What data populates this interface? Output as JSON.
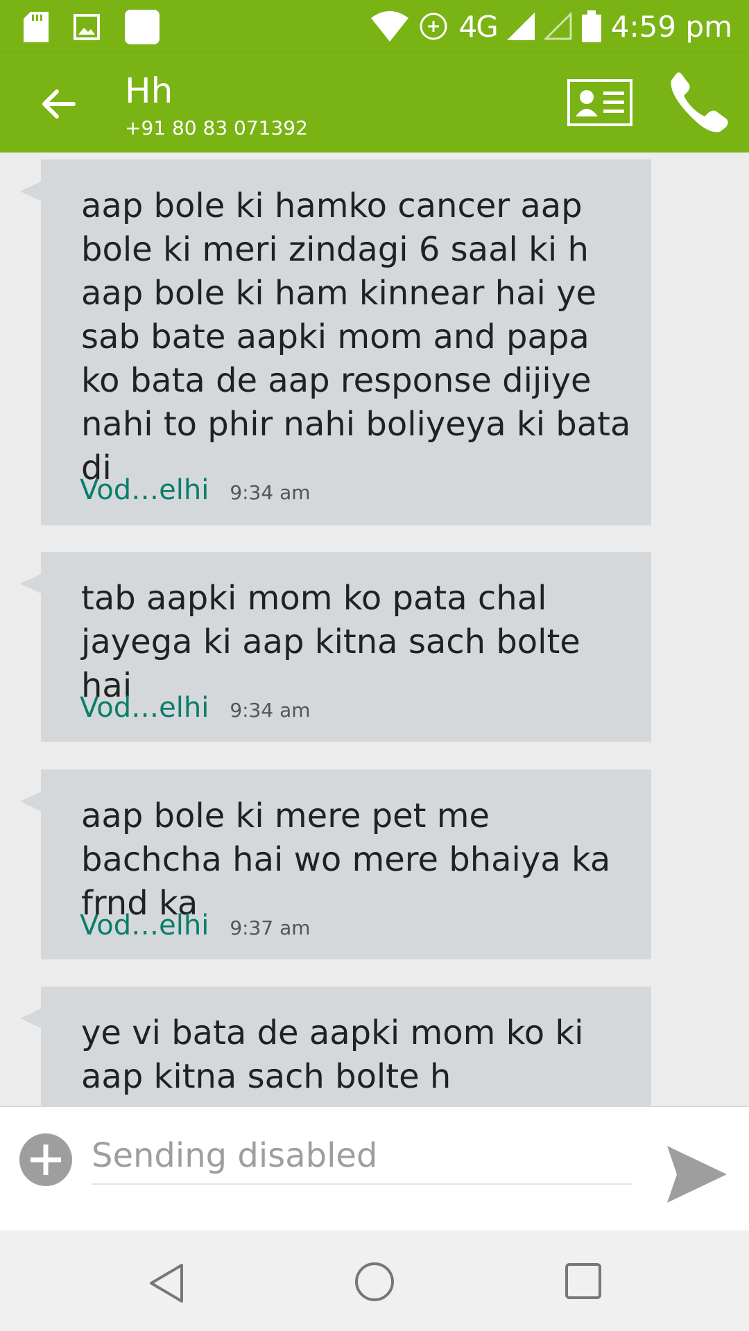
{
  "status_bar": {
    "network": "4G",
    "time": "4:59 pm"
  },
  "header": {
    "contact_name": "Hh",
    "contact_number": "+91 80 83 071392"
  },
  "messages": [
    {
      "text": "aap bole ki hamko cancer aap bole ki meri zindagi 6 saal ki h aap bole ki ham kinnear hai ye sab bate aapki mom and papa ko bata de aap response dijiye nahi to phir nahi boliyeya ki bata di",
      "sim": "Vod…elhi",
      "time": "9:34 am"
    },
    {
      "text": "tab aapki mom ko pata chal jayega ki aap kitna sach bolte hai",
      "sim": "Vod…elhi",
      "time": "9:34 am"
    },
    {
      "text": "aap bole ki mere pet me bachcha hai wo mere bhaiya ka frnd ka",
      "sim": "Vod…elhi",
      "time": "9:37 am"
    },
    {
      "text": "ye vi bata de aapki mom ko ki aap kitna sach bolte h"
    }
  ],
  "compose": {
    "placeholder": "Sending disabled"
  },
  "colors": {
    "accent": "#7ab314",
    "bubble": "#d5d8db",
    "sim_label": "#0a7d6b"
  },
  "icons": {
    "status_left": [
      "sd-card-icon",
      "image-icon",
      "notification-square-icon"
    ],
    "status_right": [
      "wifi-icon",
      "data-transfer-icon",
      "signal-icon",
      "signal-empty-icon",
      "battery-icon"
    ],
    "toolbar": [
      "back-arrow-icon",
      "contact-card-icon",
      "phone-icon"
    ],
    "compose": [
      "add-attachment-icon",
      "send-icon"
    ],
    "nav": [
      "nav-back-icon",
      "nav-home-icon",
      "nav-recents-icon"
    ]
  }
}
